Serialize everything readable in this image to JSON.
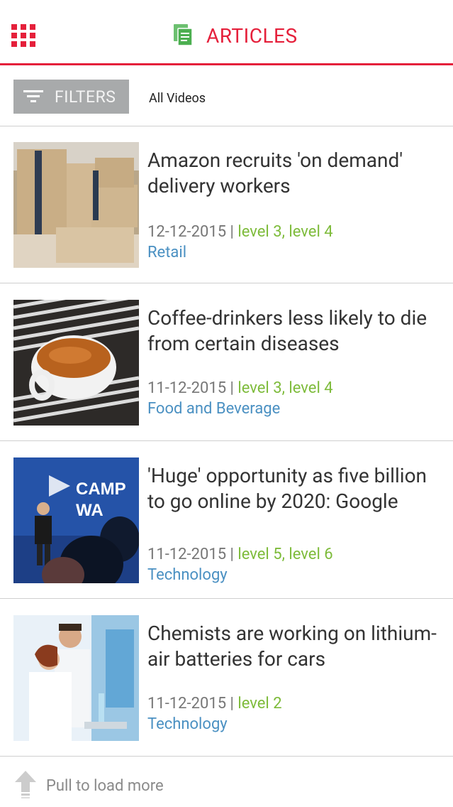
{
  "header": {
    "menu_icon": "grid-menu-icon",
    "title_icon": "document-icon",
    "title": "ARTICLES",
    "accent_color": "#e5203b"
  },
  "filter_bar": {
    "filters_label": "FILTERS",
    "filters_icon": "filter-lines-icon",
    "active_filter": "All Videos"
  },
  "articles": [
    {
      "title": "Amazon recruits 'on demand' delivery workers",
      "date": "12-12-2015",
      "separator": " | ",
      "levels": "level 3, level 4",
      "category": "Retail",
      "image": "amazon-boxes-image"
    },
    {
      "title": "Coffee-drinkers less likely to die from certain diseases",
      "date": "11-12-2015",
      "separator": " | ",
      "levels": "level 3, level 4",
      "category": "Food and Beverage",
      "image": "espresso-cup-image"
    },
    {
      "title": "'Huge' opportunity as five billion to go online by 2020: Google",
      "date": "11-12-2015",
      "separator": " | ",
      "levels": "level 5, level 6",
      "category": "Technology",
      "image": "conference-speaker-image"
    },
    {
      "title": "Chemists are working on lithium-air batteries for cars",
      "date": "11-12-2015",
      "separator": " | ",
      "levels": "level 2",
      "category": "Technology",
      "image": "lab-chemists-image"
    }
  ],
  "footer": {
    "icon": "arrow-up-icon",
    "label": "Pull to load more"
  },
  "colors": {
    "level": "#7dbb3a",
    "category": "#4a90c2",
    "doc_icon": "#4caf50"
  }
}
